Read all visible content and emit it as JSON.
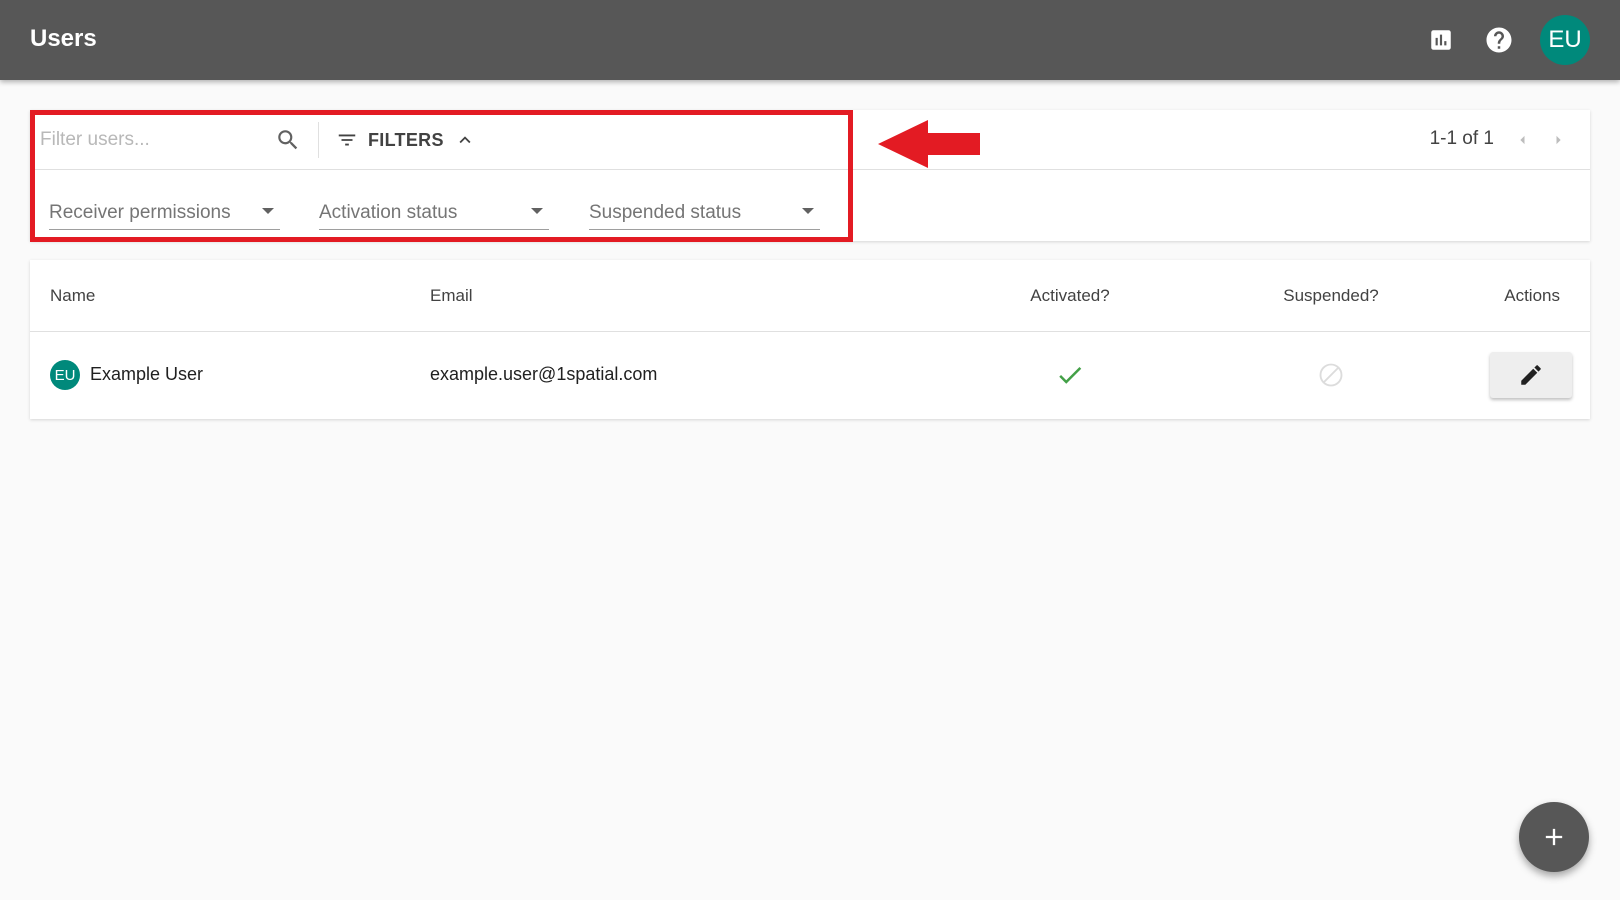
{
  "header": {
    "title": "Users",
    "avatar_initials": "EU",
    "icons": [
      "bar-chart-icon",
      "help-icon"
    ],
    "avatar_color": "#00897b",
    "bar_color": "#575757"
  },
  "toolbar": {
    "search_placeholder": "Filter users...",
    "filters_label": "FILTERS",
    "pagination_text": "1-1 of 1",
    "selects": [
      {
        "label": "Receiver permissions"
      },
      {
        "label": "Activation status"
      },
      {
        "label": "Suspended status"
      }
    ]
  },
  "annotation": {
    "color": "#e31b23"
  },
  "table": {
    "columns": [
      "Name",
      "Email",
      "Activated?",
      "Suspended?",
      "Actions"
    ],
    "rows": [
      {
        "avatar_initials": "EU",
        "name": "Example User",
        "email": "example.user@1spatial.com",
        "activated": true,
        "suspended": false
      }
    ]
  },
  "fab": {
    "icon": "plus-icon"
  }
}
